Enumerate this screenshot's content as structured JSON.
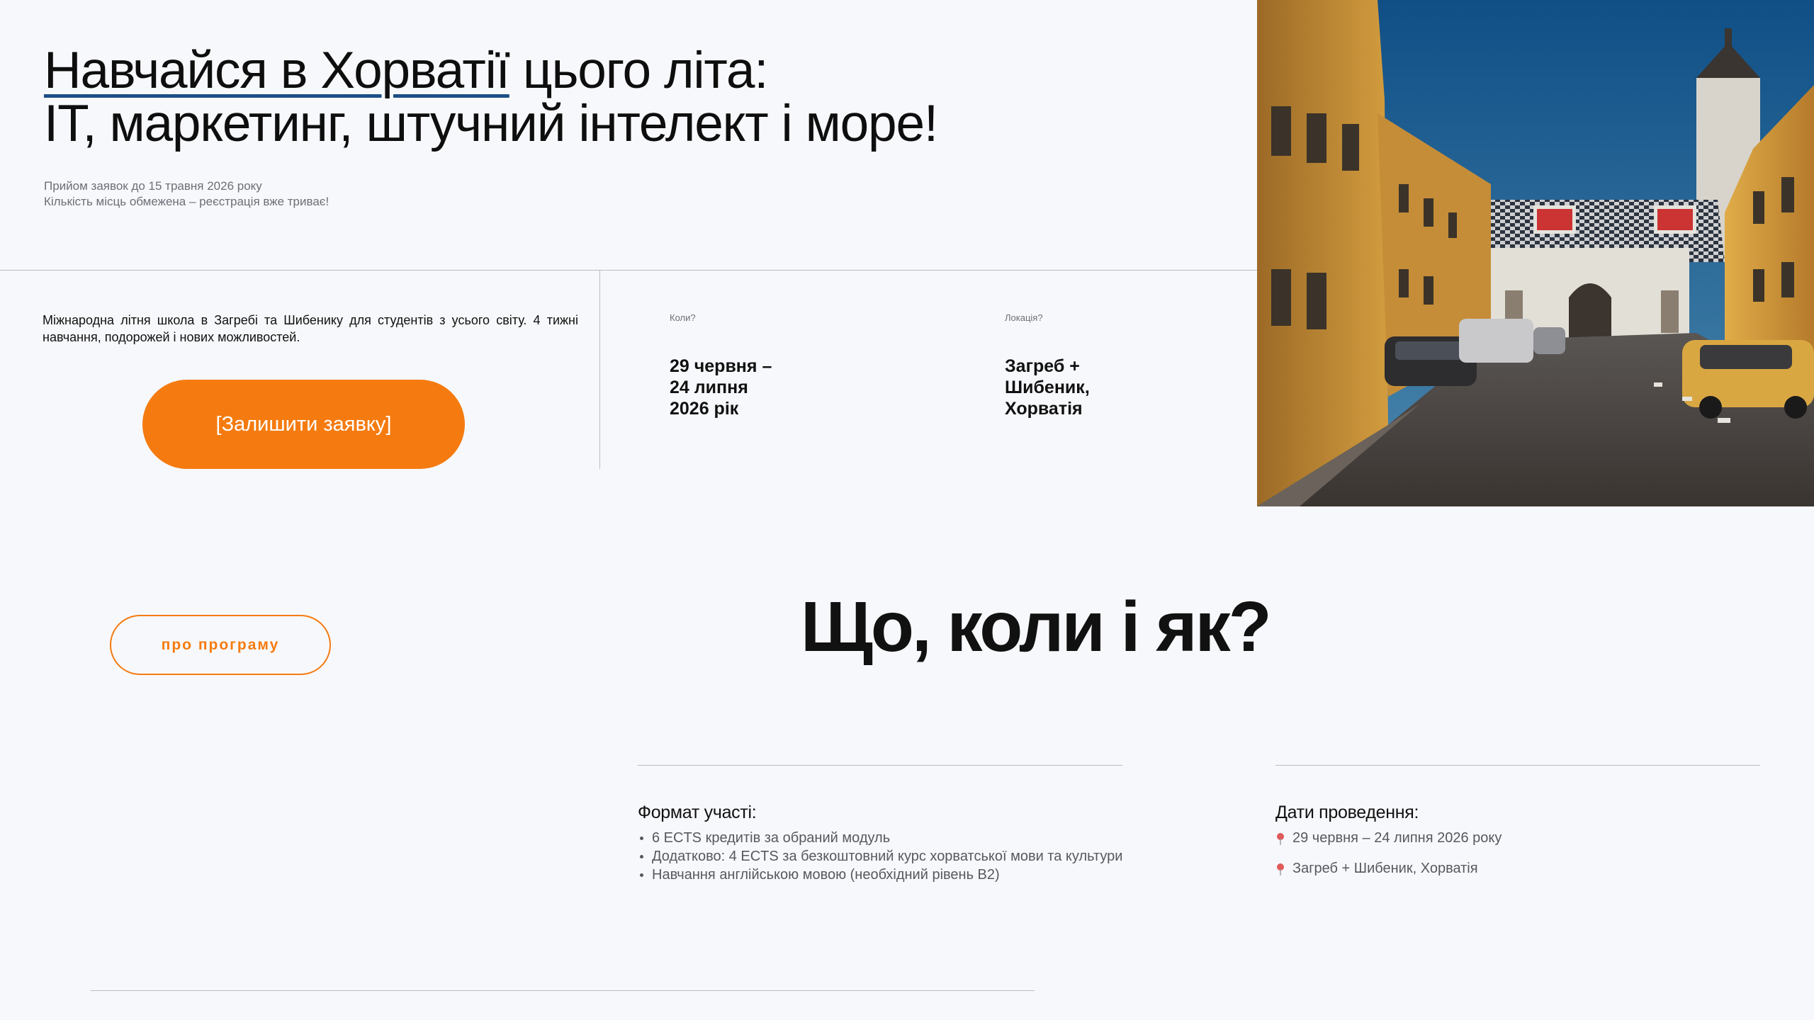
{
  "hero": {
    "title_part1": "Навчайся в Хорватії",
    "title_part2": " цього літа:",
    "title_line2": "IT, маркетинг, штучний інтелект і море!",
    "note1": "Прийом заявок до 15 травня 2026 року",
    "note2": "Кількість місць обмежена – реєстрація вже триває!"
  },
  "intro": {
    "text": "Міжнародна літня школа в Загребі та Шибенику для студентів з усього світу. 4 тижні навчання, подорожей і нових можливостей.",
    "cta_label": "[Залишити заявку]"
  },
  "info": {
    "when_label": "Коли?",
    "when_value": "29 червня –\n24 липня\n2026 рік",
    "where_label": "Локація?",
    "where_value": "Загреб +\nШибеник,\nХорватія"
  },
  "section": {
    "program_button_label": "про програму",
    "title": "Що, коли і як?"
  },
  "format": {
    "heading": "Формат участі:",
    "items": [
      " 6 ECTS кредитів за обраний модуль",
      "Додатково: 4 ECTS за безкоштовний курс хорватської мови та культури",
      "Навчання англійською мовою (необхідний рівень B2)"
    ]
  },
  "dates": {
    "heading": "Дати проведення:",
    "period": "29 червня – 24 липня 2026 року",
    "location": "Загреб + Шибеник, Хорватія"
  },
  "colors": {
    "accent": "#f57b10",
    "underline": "#1c4f86",
    "background": "#f7f8fb"
  },
  "icons": {
    "pin": "map-pin-icon"
  }
}
